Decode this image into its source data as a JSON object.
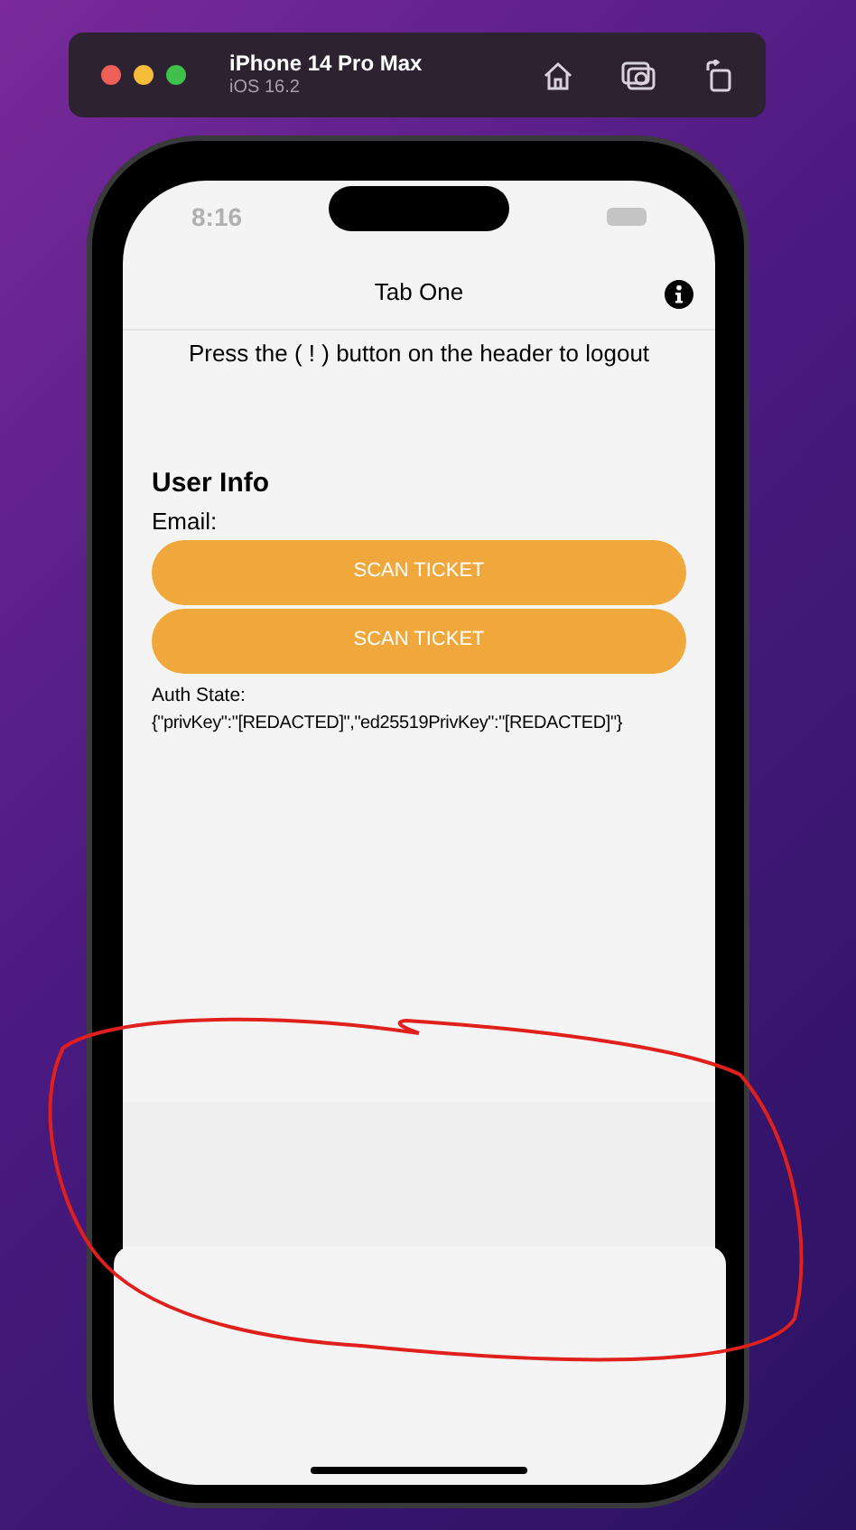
{
  "simulator": {
    "device": "iPhone 14 Pro Max",
    "os": "iOS 16.2"
  },
  "status_bar": {
    "time": "8:16"
  },
  "header": {
    "title": "Tab One"
  },
  "instruction": "Press the ( ! ) button on the header to logout",
  "section_title": "User Info",
  "email_label": "Email:",
  "buttons": [
    "SCAN TICKET",
    "SCAN TICKET"
  ],
  "auth_state": {
    "label": "Auth State:",
    "value": "{\"privKey\":\"[REDACTED]\",\"ed25519PrivKey\":\"[REDACTED]\"}"
  }
}
